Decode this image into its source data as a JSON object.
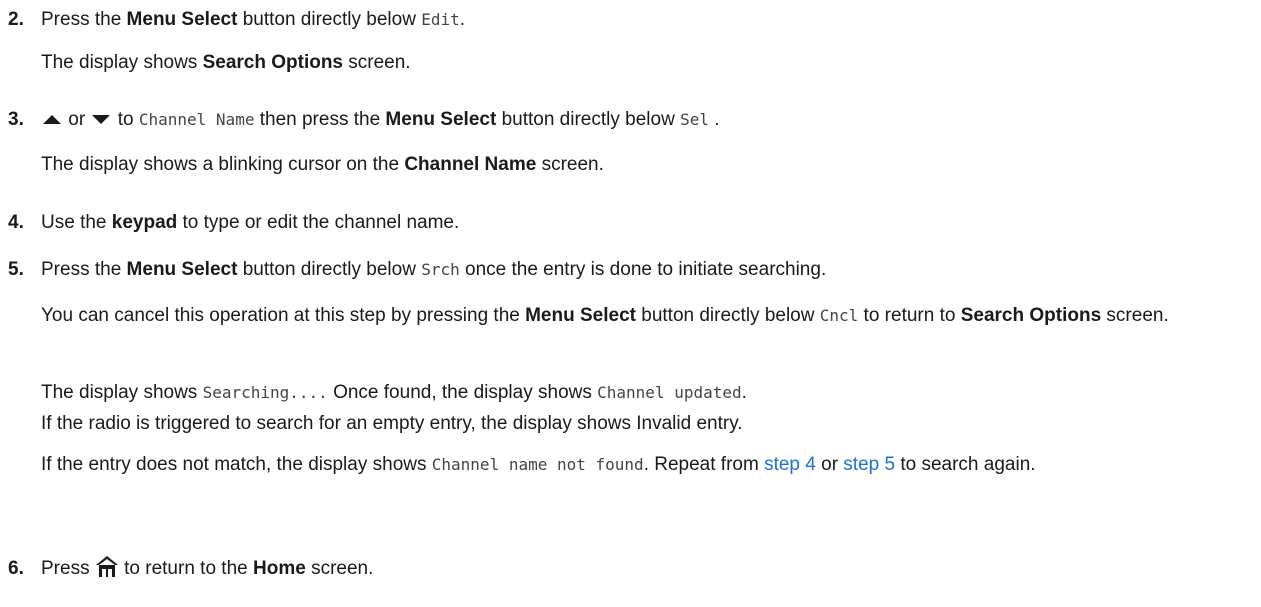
{
  "steps": [
    {
      "number": "2.",
      "parts": [
        "Press the ",
        "Menu Select",
        " button directly below ",
        "Edit",
        "."
      ],
      "result": [
        "The display shows ",
        "Search Options",
        " screen."
      ]
    },
    {
      "number": "3.",
      "up_icon": "up-arrow-icon",
      "down_icon": "down-arrow-icon",
      "parts": [
        " or ",
        " to ",
        "Channel Name",
        " then press the ",
        "Menu Select",
        " button directly below ",
        "Sel",
        " ."
      ],
      "result": [
        "The display shows a blinking cursor on the ",
        "Channel Name",
        " screen."
      ]
    },
    {
      "number": "4.",
      "parts": [
        "Use the ",
        "keypad",
        " to type or edit the channel name."
      ]
    },
    {
      "number": "5.",
      "parts": [
        "Press the ",
        "Menu Select",
        " button directly below ",
        "Srch",
        " once the entry is done to initiate searching."
      ],
      "cancel": [
        "You can cancel this operation at this step by pressing the ",
        "Menu Select",
        " button directly below ",
        "Cncl",
        " to return to ",
        "Search Options",
        " screen."
      ],
      "searching": [
        "The display shows ",
        "Searching....",
        " Once found, the display shows ",
        "Channel updated",
        "."
      ],
      "empty": "If the radio is triggered to search for an empty entry, the display shows Invalid entry.",
      "nomatch": [
        "If the entry does not match, the display shows ",
        "Channel name not found",
        ". Repeat from ",
        "step 4",
        " or ",
        "step 5",
        " to search again."
      ]
    },
    {
      "number": "6.",
      "home_icon": "home-icon",
      "parts": [
        "Press ",
        " to return to the ",
        "Home",
        " screen."
      ]
    }
  ],
  "colors": {
    "text": "#1a1a1a",
    "link": "#1a73d8",
    "mono": "#444444"
  }
}
